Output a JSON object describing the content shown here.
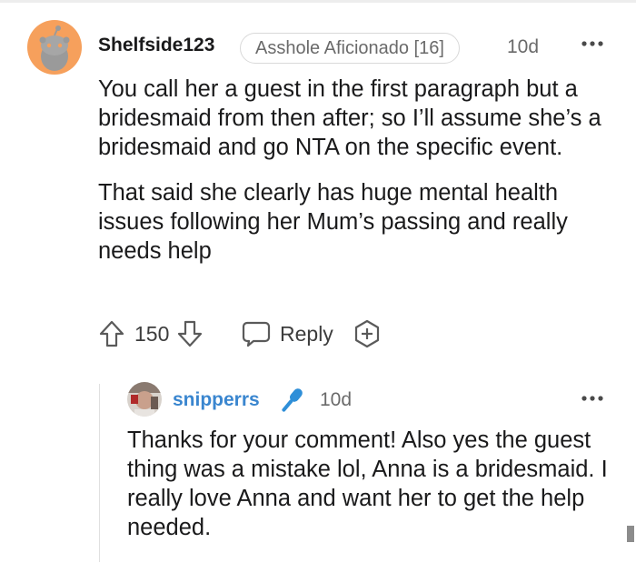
{
  "comment": {
    "username": "Shelfside123",
    "flair": "Asshole Aficionado [16]",
    "age": "10d",
    "paragraphs": [
      "You call her a guest in the first paragraph but a bridesmaid from then after; so I’ll assume she’s a bridesmaid and go NTA on the specific event.",
      "That said she clearly has huge mental health issues following her Mum’s passing and really needs help"
    ],
    "score": "150",
    "reply_label": "Reply",
    "icons": {
      "avatar": "reddit-snoo-avatar-icon",
      "more": "more-options-icon",
      "upvote": "upvote-arrow-icon",
      "downvote": "downvote-arrow-icon",
      "reply": "speech-bubble-icon",
      "award": "award-plus-icon"
    }
  },
  "reply": {
    "username": "snipperrs",
    "age": "10d",
    "text": "Thanks for your comment! Also yes the guest thing was a mistake lol, Anna is a bridesmaid. I really love Anna and want her to get the help needed.",
    "icons": {
      "avatar": "user-avatar-icon",
      "op_badge": "microphone-icon",
      "more": "more-options-icon"
    }
  },
  "colors": {
    "avatar_bg": "#f6a05c",
    "op_blue": "#3a86cf",
    "text": "#1a1a1b",
    "meta": "#6a6a6a"
  }
}
